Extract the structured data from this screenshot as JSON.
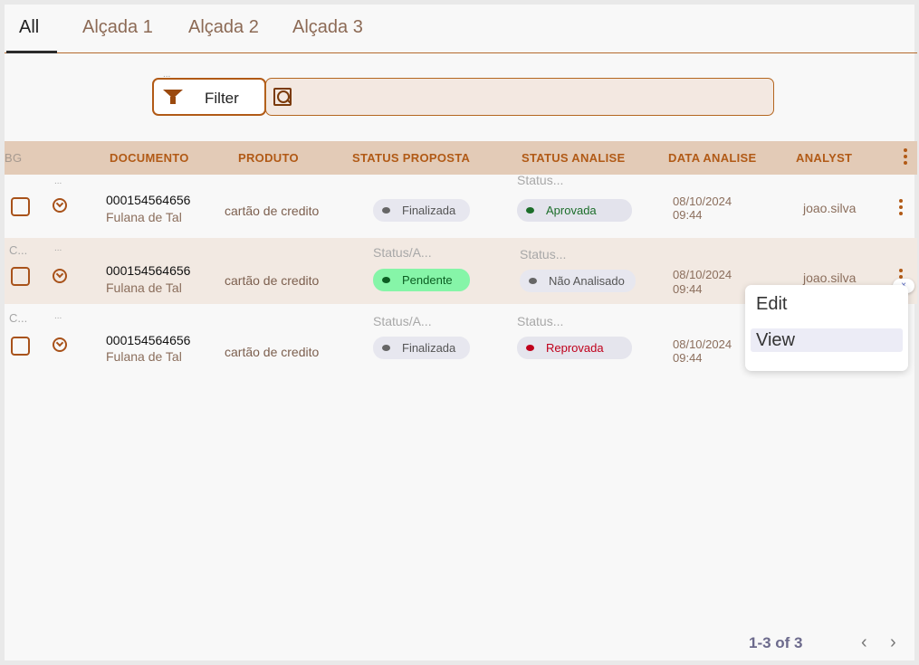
{
  "tabs": [
    {
      "label": "All"
    },
    {
      "label": "Alçada 1"
    },
    {
      "label": "Alçada 2"
    },
    {
      "label": "Alçada 3"
    }
  ],
  "filter": {
    "dots": "...",
    "label": "Filter",
    "search_value": "",
    "search_placeholder": ""
  },
  "columns": {
    "bg": "BG",
    "documento": "DOCUMENTO",
    "produto": "PRODUTO",
    "status_proposta": "STATUS PROPOSTA",
    "status_analise": "STATUS ANALISE",
    "data_analise": "DATA ANALISE",
    "analyst": "ANALYST"
  },
  "rows": [
    {
      "top_left": "",
      "dots": "...",
      "documento": "000154564656",
      "nome": "Fulana de Tal",
      "produto": "cartão de credito",
      "proposta_label": "",
      "proposta": "Finalizada",
      "analise_label": "Status...",
      "analise": "Aprovada",
      "data": "08/10/2024",
      "hora": "09:44",
      "analyst": "joao.silva"
    },
    {
      "top_left": "C...",
      "dots": "...",
      "documento": "000154564656",
      "nome": "Fulana de Tal",
      "produto": "cartão de credito",
      "proposta_label": "Status/A...",
      "proposta": "Pendente",
      "analise_label": "Status...",
      "analise": "Não Analisado",
      "data": "08/10/2024",
      "hora": "09:44",
      "analyst": "joao.silva"
    },
    {
      "top_left": "C...",
      "dots": "...",
      "documento": "000154564656",
      "nome": "Fulana de Tal",
      "produto": "cartão de credito",
      "proposta_label": "Status/A...",
      "proposta": "Finalizada",
      "analise_label": "Status...",
      "analise": "Reprovada",
      "data": "08/10/2024",
      "hora": "09:44",
      "analyst": ""
    }
  ],
  "menu": {
    "items": [
      {
        "label": "Edit"
      },
      {
        "label": "View"
      }
    ],
    "close": "×"
  },
  "pagination": {
    "range": "1-3 of 3",
    "prev": "‹",
    "next": "›"
  },
  "colors": {
    "accent": "#b15a16",
    "header_bg": "#e3cbb7",
    "alt_row": "#f2e9e2",
    "pending": "#86f5a8"
  }
}
